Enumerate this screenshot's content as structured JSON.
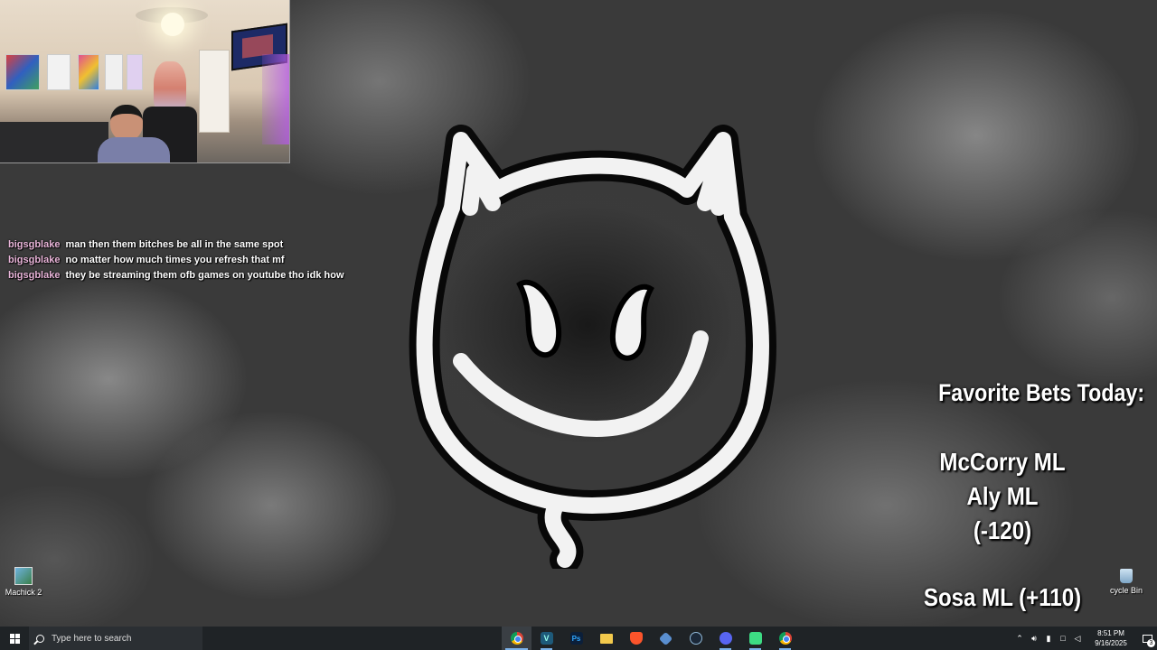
{
  "chat": [
    {
      "user": "bigsgblake",
      "message": "man then them bitches be all in the same spot"
    },
    {
      "user": "bigsgblake",
      "message": "no matter how much times you refresh that mf"
    },
    {
      "user": "bigsgblake",
      "message": "they be streaming them ofb games on youtube tho idk how"
    }
  ],
  "bets": {
    "title": "Favorite Bets Today:",
    "lines": [
      "McCorry ML",
      "Aly ML",
      "(-120)",
      "Sosa ML (+110)"
    ]
  },
  "desktop_icons": {
    "machick": "Machick 2",
    "recycle_bin": "cycle Bin"
  },
  "taskbar": {
    "search_placeholder": "Type here to search",
    "time": "8:51 PM",
    "date": "9/16/2025",
    "notification_count": "3",
    "apps": [
      "chrome-icon",
      "vegas-icon",
      "photoshop-icon",
      "file-explorer-icon",
      "brave-icon",
      "diamond-app-icon",
      "steam-icon",
      "discord-icon",
      "android-icon",
      "chrome-icon"
    ]
  },
  "colors": {
    "chat_username": "#e8b4d8",
    "taskbar_bg": "#1f2326",
    "accent": "#7bb1e8"
  }
}
